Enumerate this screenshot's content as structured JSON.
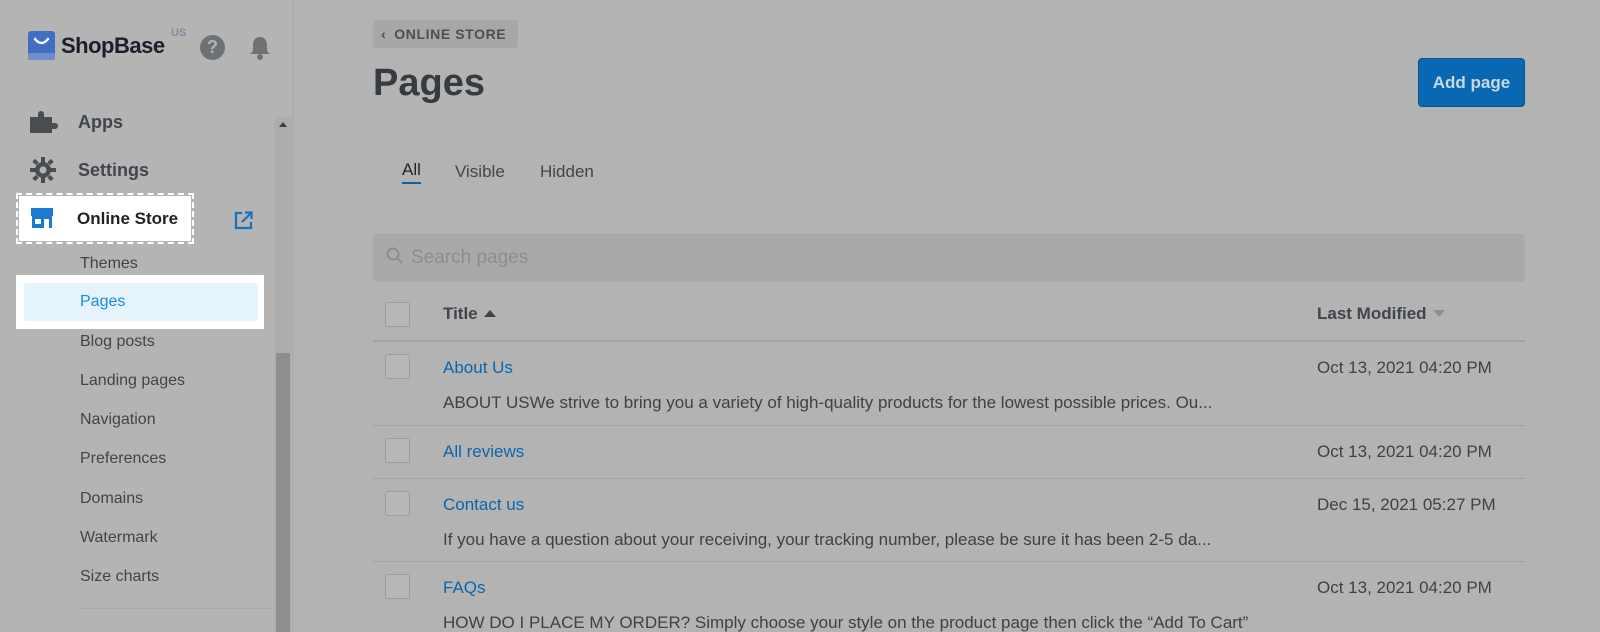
{
  "app": {
    "brand": "ShopBase",
    "region": "US"
  },
  "sidebar": {
    "items": [
      {
        "label": "Apps",
        "icon": "puzzle-icon"
      },
      {
        "label": "Settings",
        "icon": "gear-icon"
      },
      {
        "label": "Online Store",
        "icon": "storefront-icon"
      }
    ],
    "online_store_sub": [
      {
        "label": "Themes"
      },
      {
        "label": "Pages",
        "active": true
      },
      {
        "label": "Blog posts"
      },
      {
        "label": "Landing pages"
      },
      {
        "label": "Navigation"
      },
      {
        "label": "Preferences"
      },
      {
        "label": "Domains"
      },
      {
        "label": "Watermark"
      },
      {
        "label": "Size charts"
      }
    ]
  },
  "main": {
    "breadcrumb": "ONLINE STORE",
    "title": "Pages",
    "add_button": "Add page",
    "tabs": [
      {
        "label": "All",
        "active": true
      },
      {
        "label": "Visible"
      },
      {
        "label": "Hidden"
      }
    ],
    "search": {
      "placeholder": "Search pages"
    },
    "table": {
      "columns": [
        "Title",
        "Last Modified"
      ],
      "rows": [
        {
          "title": "About Us",
          "excerpt": "ABOUT USWe strive to bring you a variety of high-quality products for the lowest possible prices. Ou...",
          "modified": "Oct 13, 2021 04:20 PM"
        },
        {
          "title": "All reviews",
          "excerpt": "",
          "modified": "Oct 13, 2021 04:20 PM"
        },
        {
          "title": "Contact us",
          "excerpt": "If you have a question about your receiving, your tracking number, please be sure it has been 2-5 da...",
          "modified": "Dec 15, 2021 05:27 PM"
        },
        {
          "title": "FAQs",
          "excerpt": "HOW DO I PLACE MY ORDER?  Simply choose your style on the product page then click the “Add To Cart”",
          "modified": "Oct 13, 2021 04:20 PM"
        }
      ]
    }
  },
  "colors": {
    "overlay_bg": "#b3b3b3",
    "accent": "#0968b1",
    "link": "#0b65ad",
    "active_sub": "#1a8ae0"
  }
}
